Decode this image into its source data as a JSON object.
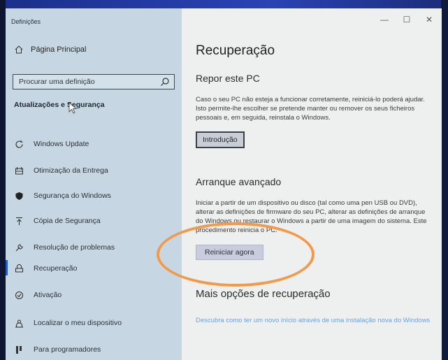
{
  "window": {
    "title": "Definições",
    "controls": {
      "minimize": "—",
      "maximize": "☐",
      "close": "✕"
    }
  },
  "sidebar": {
    "home_label": "Página Principal",
    "search_placeholder": "Procurar uma definição",
    "section_title": "Atualizações e Segurança",
    "items": [
      {
        "label": "Windows Update",
        "icon": "refresh-icon"
      },
      {
        "label": "Otimização da Entrega",
        "icon": "delivery-icon"
      },
      {
        "label": "Segurança do Windows",
        "icon": "shield-icon"
      },
      {
        "label": "Cópia de Segurança",
        "icon": "backup-icon"
      },
      {
        "label": "Resolução de problemas",
        "icon": "wrench-icon"
      },
      {
        "label": "Recuperação",
        "icon": "recovery-icon"
      },
      {
        "label": "Ativação",
        "icon": "check-circle-icon"
      },
      {
        "label": "Localizar o meu dispositivo",
        "icon": "person-pin-icon"
      },
      {
        "label": "Para programadores",
        "icon": "developer-icon"
      }
    ],
    "active_index": 5
  },
  "main": {
    "title": "Recuperação",
    "reset": {
      "heading": "Repor este PC",
      "text": "Caso o seu PC não esteja a funcionar corretamente, reiniciá-lo poderá ajudar. Isto permite-lhe escolher se pretende manter ou remover os seus ficheiros pessoais e, em seguida, reinstala o Windows.",
      "button": "Introdução"
    },
    "advanced": {
      "heading": "Arranque avançado",
      "text": "Iniciar a partir de um dispositivo ou disco (tal como uma pen USB ou DVD), alterar as definições de firmware do seu PC, alterar as definições de arranque do Windows ou restaurar o Windows a partir de uma imagem do sistema. Este procedimento reinicia o PC.",
      "button": "Reiniciar agora"
    },
    "more": {
      "heading": "Mais opções de recuperação",
      "link": "Descubra como ter um novo início através de uma instalação nova do Windows"
    }
  },
  "colors": {
    "sidebar_bg": "#c6d7e3",
    "main_bg": "#eef0f0",
    "accent": "#1f5fbf",
    "annotation": "#f29a4a",
    "link": "#6fa0d8"
  }
}
